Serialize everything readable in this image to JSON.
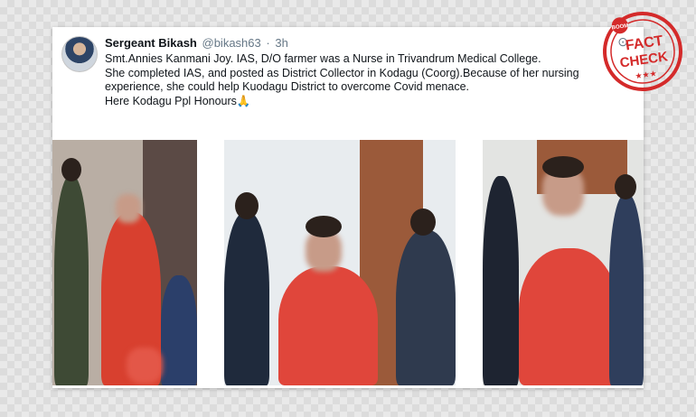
{
  "tweet": {
    "author_name": "Sergeant Bikash",
    "author_handle": "@bikash63",
    "separator": "·",
    "time": "3h",
    "more_icon": "more-dots-icon",
    "lines": [
      "Smt.Annies Kanmani Joy. IAS, D/O farmer was a Nurse in Trivandrum Medical College.",
      "She completed IAS, and posted as District Collector in Kodagu (Coorg).Because of her nursing experience, she could help Kuodagu District to overcome  Covid menace.",
      "Here  Kodagu Ppl  Honours🙏"
    ]
  },
  "stamp": {
    "top_text": "BOOM",
    "line1": "FACT",
    "line2": "CHECK",
    "stars": "★★★",
    "color": "#d42a2a"
  },
  "colors": {
    "dress": "#e0463b",
    "wall": "#e8ecef",
    "door": "#9b5a3a"
  }
}
